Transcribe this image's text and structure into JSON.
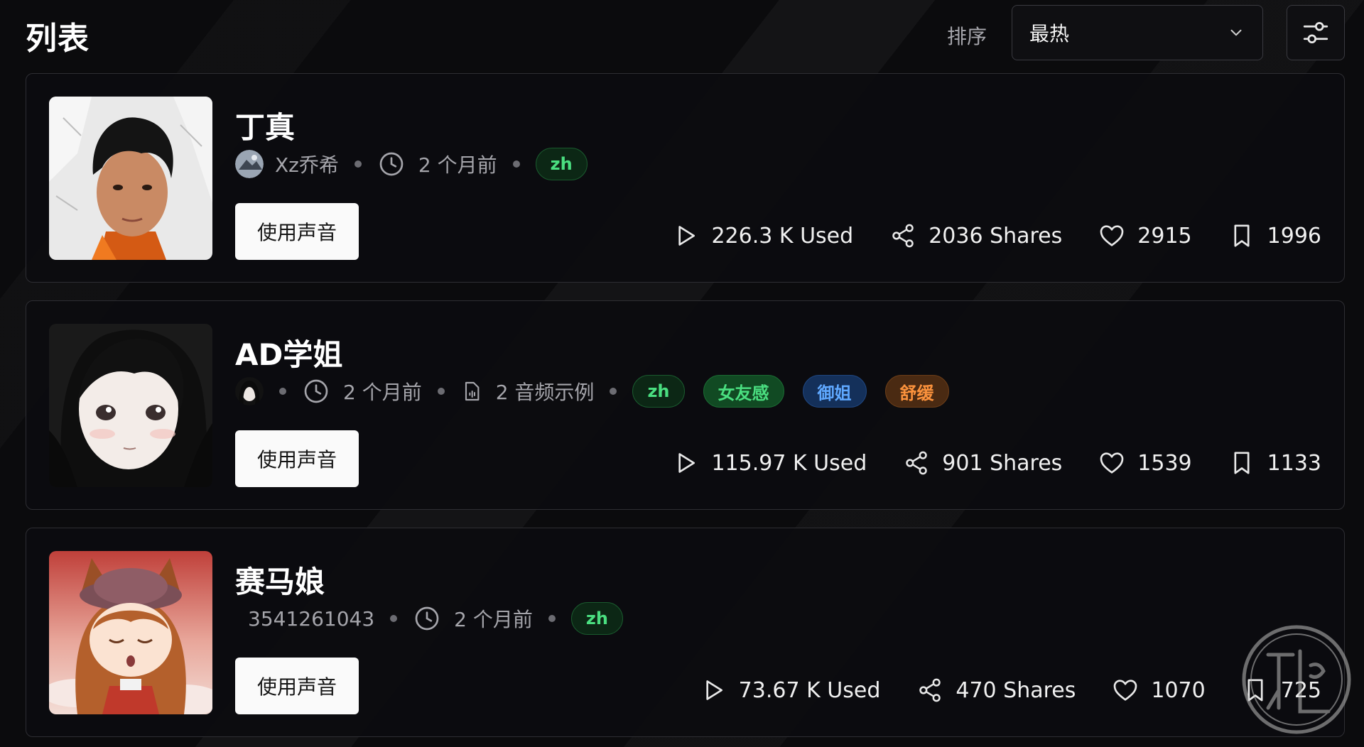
{
  "header": {
    "title": "列表",
    "sort_label": "排序",
    "sort_value": "最热",
    "sort_icon": "chevron-down-icon",
    "filter_icon": "sliders-icon"
  },
  "colors": {
    "background": "#0b0b0d",
    "card_border": "#2e2e33",
    "tag_green": "#4ade80",
    "tag_blue": "#5fa8ff",
    "tag_orange": "#fb923c",
    "button_bg": "#fafafa"
  },
  "cards": [
    {
      "name": "丁真",
      "author": "Xz乔希",
      "time": "2 个月前",
      "tags": [
        "zh"
      ],
      "button": "使用声音",
      "used": "226.3 K Used",
      "shares": "2036 Shares",
      "likes": "2915",
      "bookmarks": "1996"
    },
    {
      "name": "AD学姐",
      "time": "2 个月前",
      "samples": "2 音频示例",
      "tags": [
        "zh",
        "女友感",
        "御姐",
        "舒缓"
      ],
      "button": "使用声音",
      "used": "115.97 K Used",
      "shares": "901 Shares",
      "likes": "1539",
      "bookmarks": "1133"
    },
    {
      "name": "赛马娘",
      "author": "3541261043",
      "time": "2 个月前",
      "tags": [
        "zh"
      ],
      "button": "使用声音",
      "used": "73.67 K Used",
      "shares": "470 Shares",
      "likes": "1070",
      "bookmarks": "725"
    }
  ]
}
